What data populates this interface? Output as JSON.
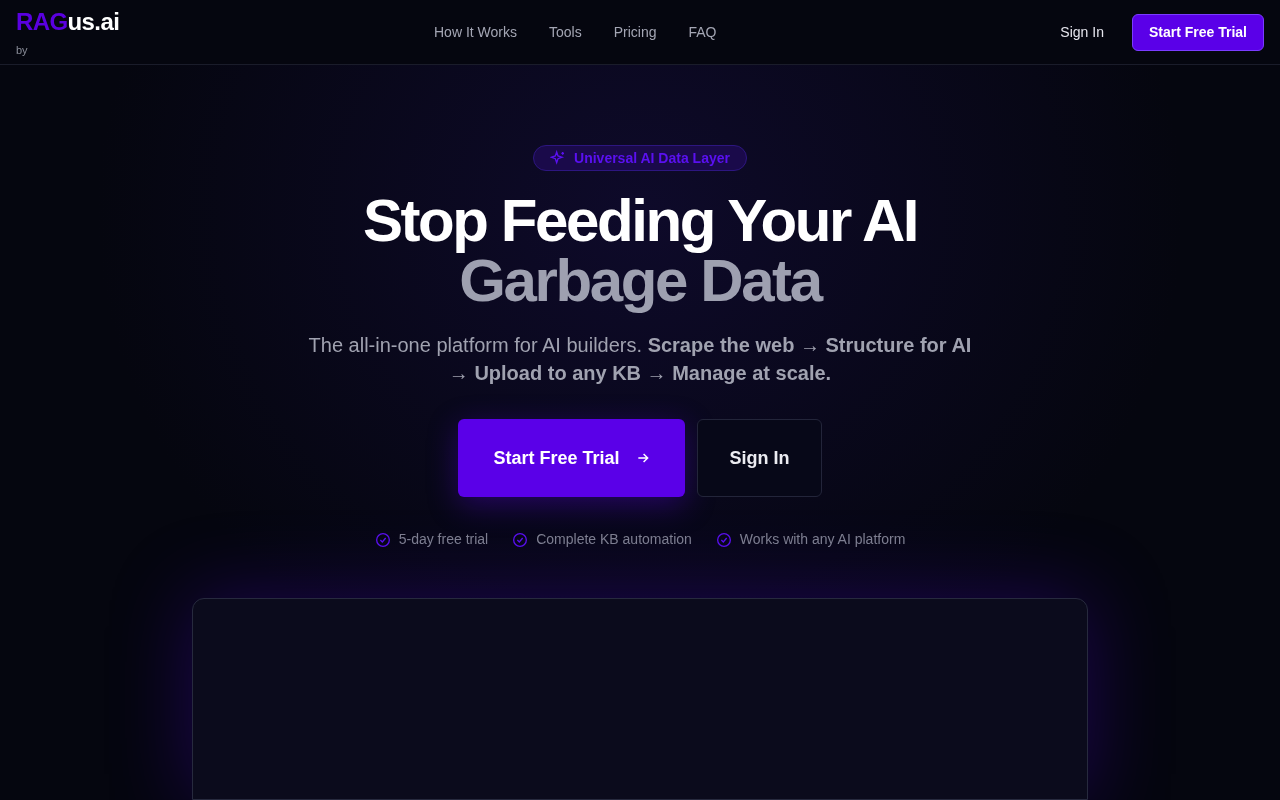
{
  "header": {
    "logo": {
      "accent": "RAG",
      "rest": "us.ai",
      "byline": "by"
    },
    "nav": [
      "How It Works",
      "Tools",
      "Pricing",
      "FAQ"
    ],
    "sign_in": "Sign In",
    "cta": "Start Free Trial"
  },
  "hero": {
    "badge": "Universal AI Data Layer",
    "headline": [
      "Stop Feeding Your AI",
      "Garbage Data"
    ],
    "subtitle": "The all-in-one platform for AI builders. **Scrape the web** → **Structure for AI** → **Upload to any KB** → **Manage at scale.**",
    "primary_button": "Start Free Trial",
    "secondary_button": "Sign In",
    "features": [
      "5-day free trial",
      "Complete KB automation",
      "Works with any AI platform"
    ]
  }
}
